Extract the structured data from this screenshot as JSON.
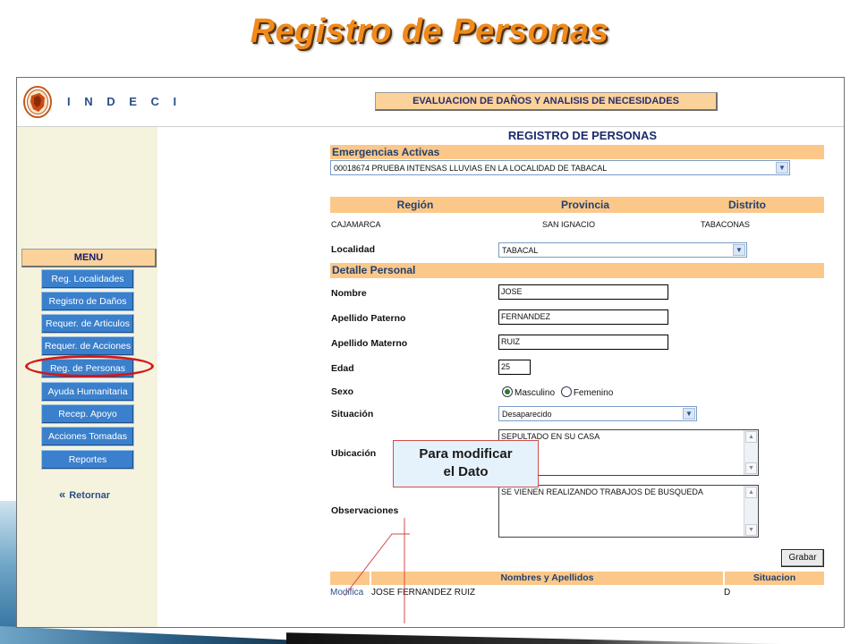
{
  "slide": {
    "title": "Registro de Personas"
  },
  "header": {
    "brand": "I N D E C I",
    "banner": "EVALUACION DE DAÑOS Y ANALISIS DE NECESIDADES"
  },
  "sidebar": {
    "menu_title": "MENU",
    "items": [
      {
        "label": "Reg. Localidades"
      },
      {
        "label": "Registro de Daños"
      },
      {
        "label": "Requer. de Articulos"
      },
      {
        "label": "Requer. de Acciones"
      },
      {
        "label": "Reg. de Personas",
        "highlighted": true
      },
      {
        "label": "Ayuda Humanitaria"
      },
      {
        "label": "Recep. Apoyo"
      },
      {
        "label": "Acciones Tomadas"
      },
      {
        "label": "Reportes"
      }
    ],
    "back_label": "Retornar",
    "back_icon": "double-chevron-left-icon",
    "highlight_color": "#d31818"
  },
  "form": {
    "heading": "REGISTRO DE PERSONAS",
    "emergencias": {
      "section": "Emergencias Activas",
      "selected": "00018674 PRUEBA INTENSAS LLUVIAS EN LA LOCALIDAD DE TABACAL"
    },
    "location": {
      "headers": {
        "region": "Región",
        "provincia": "Provincia",
        "distrito": "Distrito"
      },
      "values": {
        "region": "CAJAMARCA",
        "provincia": "SAN IGNACIO",
        "distrito": "TABACONAS"
      },
      "localidad_label": "Localidad",
      "localidad_value": "TABACAL"
    },
    "detalle": {
      "section": "Detalle Personal",
      "nombre_label": "Nombre",
      "nombre_value": "JOSE",
      "paterno_label": "Apellido Paterno",
      "paterno_value": "FERNANDEZ",
      "materno_label": "Apellido Materno",
      "materno_value": "RUIZ",
      "edad_label": "Edad",
      "edad_value": "25",
      "sexo_label": "Sexo",
      "sexo_options": [
        "Masculino",
        "Femenino"
      ],
      "sexo_selected": "Masculino",
      "situacion_label": "Situación",
      "situacion_value": "Desaparecido",
      "ubicacion_label": "Ubicación",
      "ubicacion_value": "SEPULTADO EN SU CASA",
      "observaciones_label": "Observaciones",
      "observaciones_value": "SE VIENEN REALIZANDO TRABAJOS DE BUSQUEDA"
    },
    "save_label": "Grabar"
  },
  "table": {
    "headers": [
      "",
      "Nombres y Apellidos",
      "Situacion"
    ],
    "rows": [
      {
        "action": "Modifica",
        "name": "JOSE FERNANDEZ RUIZ",
        "situacion": "D"
      }
    ]
  },
  "callout": {
    "line1": "Para modificar",
    "line2": "el Dato"
  },
  "colors": {
    "title_orange": "#f08a1a",
    "section_bar": "#fbc88a",
    "menu_button": "#3a80cc",
    "sidebar_bg": "#f5f3dd"
  }
}
